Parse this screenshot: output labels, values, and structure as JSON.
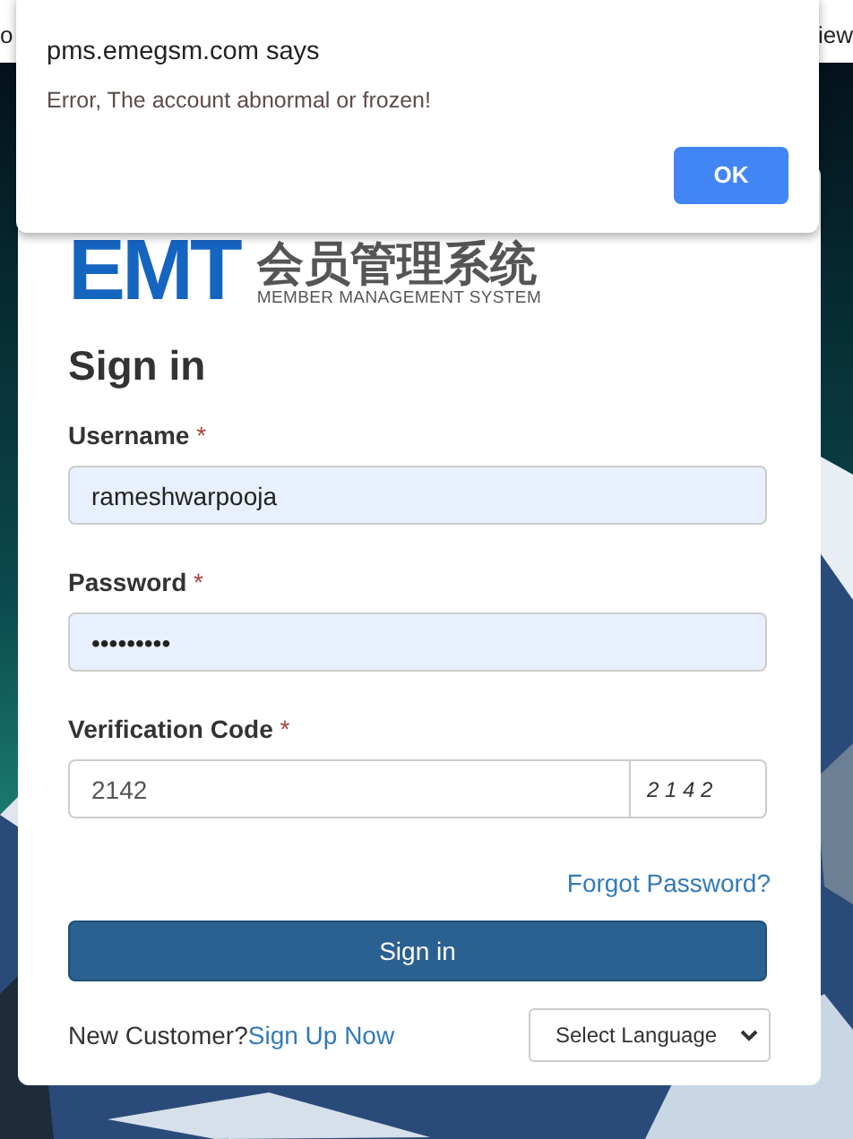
{
  "browser_edge": {
    "left_text": "o",
    "right_text": "iew"
  },
  "logo": {
    "letters": "EMT",
    "title": "会员管理系统",
    "subtitle": "MEMBER MANAGEMENT SYSTEM"
  },
  "form": {
    "heading": "Sign in",
    "fields": [
      {
        "label": "Username",
        "required_mark": "*",
        "value": "rameshwarpooja",
        "autofilled": true,
        "kind": "text"
      },
      {
        "label": "Password",
        "required_mark": "*",
        "value": "•••••••••",
        "autofilled": true,
        "kind": "text"
      },
      {
        "label": "Verification Code",
        "required_mark": "*",
        "value": "2142",
        "autofilled": false,
        "kind": "captcha",
        "captcha": "2 1 4 2"
      }
    ],
    "forgot_link": "Forgot Password?",
    "submit": "Sign in",
    "signup_prompt": "New Customer?",
    "signup_link": "Sign Up Now",
    "language_select": "Select Language"
  },
  "dialog": {
    "title": "pms.emegsm.com says",
    "message": "Error, The account abnormal or frozen!",
    "button": "OK"
  }
}
